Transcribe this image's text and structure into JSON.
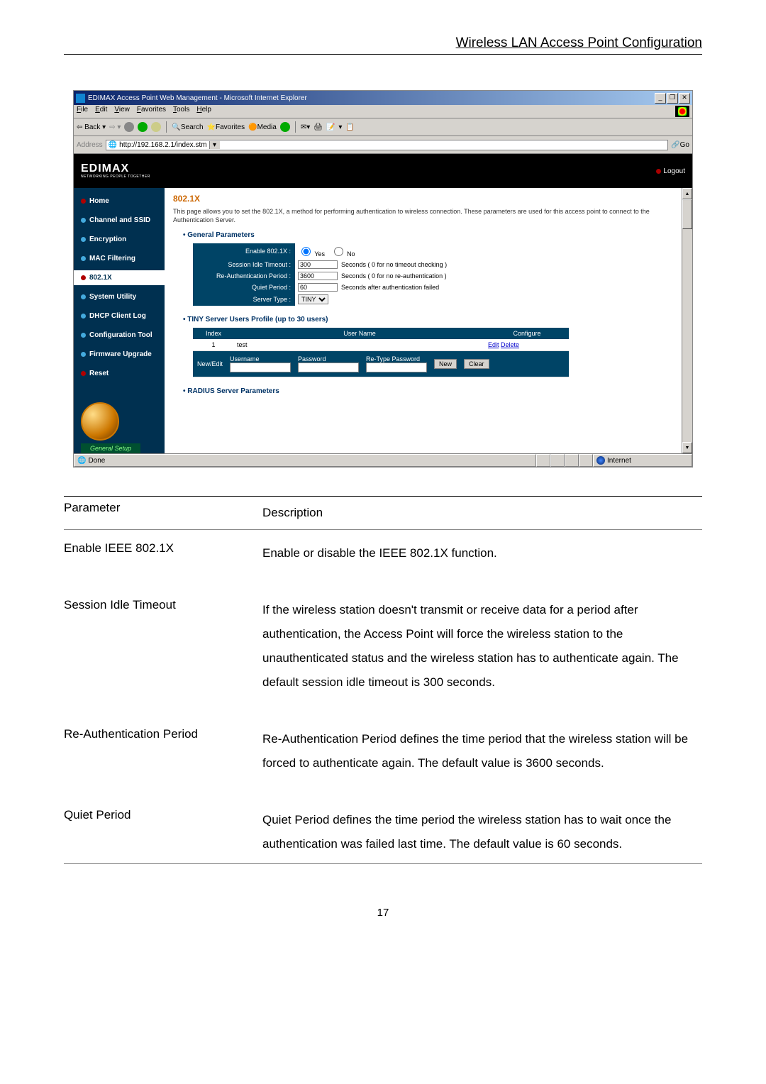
{
  "header_text": "Wireless LAN Access Point Configuration",
  "browser": {
    "title": "EDIMAX Access Point Web Management - Microsoft Internet Explorer",
    "menu": [
      "File",
      "Edit",
      "View",
      "Favorites",
      "Tools",
      "Help"
    ],
    "toolbar": {
      "back": "Back",
      "search": "Search",
      "favorites": "Favorites",
      "media": "Media"
    },
    "address_label": "Address",
    "address_url": "http://192.168.2.1/index.stm",
    "go": "Go",
    "status_done": "Done",
    "status_zone": "Internet"
  },
  "app": {
    "brand": "EDIMAX",
    "brand_sub": "NETWORKING PEOPLE TOGETHER",
    "logout": "Logout",
    "sidebar": {
      "items": [
        {
          "label": "Home"
        },
        {
          "label": "Channel and SSID"
        },
        {
          "label": "Encryption"
        },
        {
          "label": "MAC Filtering"
        },
        {
          "label": "802.1X"
        },
        {
          "label": "System Utility"
        },
        {
          "label": "DHCP Client Log"
        },
        {
          "label": "Configuration Tool"
        },
        {
          "label": "Firmware Upgrade"
        },
        {
          "label": "Reset"
        }
      ],
      "general_setup": "General Setup"
    },
    "panel": {
      "title": "802.1X",
      "desc": "This page allows you to set the 802.1X, a method for performing authentication to wireless connection. These parameters are used for this access point to connect to the Authentication Server.",
      "general_params_head": "General Parameters",
      "rows": {
        "enable_label": "Enable 802.1X :",
        "enable_yes": "Yes",
        "enable_no": "No",
        "sit_label": "Session Idle Timeout :",
        "sit_value": "300",
        "sit_suffix": "Seconds ( 0 for no timeout checking )",
        "rap_label": "Re-Authentication Period :",
        "rap_value": "3600",
        "rap_suffix": "Seconds ( 0 for no re-authentication )",
        "qp_label": "Quiet Period :",
        "qp_value": "60",
        "qp_suffix": "Seconds after authentication failed",
        "st_label": "Server Type :",
        "st_value": "TINY"
      },
      "tiny_head": "TINY Server Users Profile (up to 30 users)",
      "users_th": {
        "index": "Index",
        "username": "User Name",
        "configure": "Configure"
      },
      "users": [
        {
          "index": "1",
          "username": "test",
          "edit": "Edit",
          "delete": "Delete"
        }
      ],
      "newedit": {
        "label": "New/Edit",
        "un": "Username",
        "pw": "Password",
        "rpw": "Re-Type Password",
        "new_btn": "New",
        "clear_btn": "Clear"
      },
      "radius_head": "RADIUS Server Parameters"
    }
  },
  "doc": {
    "h_param": "Parameter",
    "h_desc": "Description",
    "rows": [
      {
        "p": "Enable IEEE 802.1X",
        "d": "Enable or disable the IEEE 802.1X function."
      },
      {
        "p": "Session Idle Timeout",
        "d": "If the wireless station doesn't transmit or receive data for a period after authentication, the Access Point will force the wireless station to the unauthenticated status and the wireless station has to authenticate again. The default session idle timeout is 300 seconds."
      },
      {
        "p": "Re-Authentication Period",
        "d": "Re-Authentication Period defines the time period that the wireless station will be forced to authenticate again. The default value is 3600 seconds."
      },
      {
        "p": "Quiet Period",
        "d": "Quiet Period defines the time period the wireless station has to wait once the authentication was failed last time. The default value is 60 seconds."
      }
    ]
  },
  "page_number": "17"
}
